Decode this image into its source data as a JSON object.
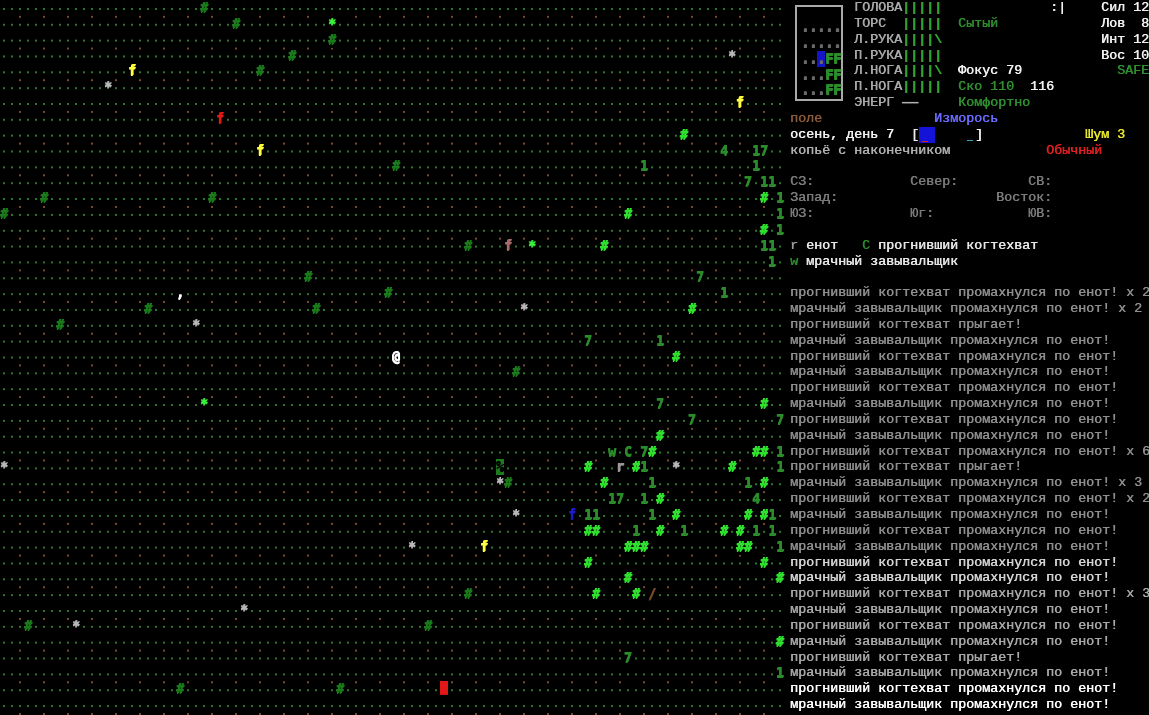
{
  "map": {
    "rows": [
      {
        "segments": [
          {
            "text": "                         #",
            "color": "#1b7a1b"
          }
        ]
      },
      {
        "segments": [
          {
            "text": "                             #",
            "color": "#1b7a1b"
          },
          {
            "text": "           *",
            "color": "#3af03a"
          }
        ]
      },
      {
        "segments": [
          {
            "text": "                                         #",
            "color": "#1b7a1b"
          }
        ]
      },
      {
        "segments": [
          {
            "text": "                                    #",
            "color": "#1b7a1b"
          },
          {
            "text": "                                                      *",
            "color": "#b8b8b8"
          }
        ]
      },
      {
        "segments": [
          {
            "text": "                f",
            "color": "#ffff40"
          },
          {
            "text": "               #",
            "color": "#1b7a1b"
          }
        ]
      },
      {
        "segments": [
          {
            "text": "             *",
            "color": "#b8b8b8"
          }
        ]
      },
      {
        "segments": [
          {
            "text": "                                                                                            f",
            "color": "#ffff40"
          }
        ]
      },
      {
        "segments": [
          {
            "text": "                           f",
            "color": "#e01818"
          }
        ]
      },
      {
        "segments": [
          {
            "text": "                                                                                     #",
            "color": "#30e030"
          }
        ]
      },
      {
        "segments": [
          {
            "text": "                                f",
            "color": "#ffff40"
          },
          {
            "text": "                                                         4",
            "color": "#2b8c2b"
          },
          {
            "text": "   17",
            "color": "#2b8c2b"
          }
        ]
      },
      {
        "segments": [
          {
            "text": "                                                 #",
            "color": "#1b7a1b"
          },
          {
            "text": "                              1",
            "color": "#2b8c2b"
          },
          {
            "text": "             1",
            "color": "#2b8c2b"
          }
        ]
      },
      {
        "segments": [
          {
            "text": "                                                                                             7",
            "color": "#2b8c2b"
          },
          {
            "text": " 11",
            "color": "#2b8c2b"
          }
        ]
      },
      {
        "segments": [
          {
            "text": "     #",
            "color": "#1b7a1b"
          },
          {
            "text": "                    #",
            "color": "#1b7a1b"
          },
          {
            "text": "                                                                    #",
            "color": "#30e030"
          },
          {
            "text": " 1",
            "color": "#2b8c2b"
          }
        ]
      },
      {
        "segments": [
          {
            "text": "#",
            "color": "#1b7a1b"
          },
          {
            "text": "                                                                             #",
            "color": "#30e030"
          },
          {
            "text": "                  1",
            "color": "#2b8c2b"
          }
        ]
      },
      {
        "segments": [
          {
            "text": "                                                                                               #",
            "color": "#30e030"
          },
          {
            "text": " 1",
            "color": "#2b8c2b"
          }
        ]
      },
      {
        "segments": [
          {
            "text": "                                                          #",
            "color": "#1b7a1b"
          },
          {
            "text": "    f",
            "color": "#a86a6a"
          },
          {
            "text": "  *",
            "color": "#3af03a"
          },
          {
            "text": "        #",
            "color": "#30e030"
          },
          {
            "text": "                   11",
            "color": "#2b8c2b"
          }
        ]
      },
      {
        "segments": [
          {
            "text": "                                                                                                1",
            "color": "#2b8c2b"
          }
        ]
      },
      {
        "segments": [
          {
            "text": "                                      #",
            "color": "#1b7a1b"
          },
          {
            "text": "                                                7",
            "color": "#2b8c2b"
          }
        ]
      },
      {
        "segments": [
          {
            "text": "                      ,",
            "color": "#ffffff"
          },
          {
            "text": "                         #",
            "color": "#1b7a1b"
          },
          {
            "text": "                                         1",
            "color": "#2b8c2b"
          }
        ]
      },
      {
        "segments": [
          {
            "text": "                  #",
            "color": "#1b7a1b"
          },
          {
            "text": "                    #",
            "color": "#1b7a1b"
          },
          {
            "text": "                         *",
            "color": "#b8b8b8"
          },
          {
            "text": "                    #",
            "color": "#30e030"
          }
        ]
      },
      {
        "segments": [
          {
            "text": "       #",
            "color": "#1b7a1b"
          },
          {
            "text": "                *",
            "color": "#b8b8b8"
          }
        ]
      },
      {
        "segments": [
          {
            "text": "                                                                         7",
            "color": "#2b8c2b"
          },
          {
            "text": "        1",
            "color": "#2b8c2b"
          }
        ]
      },
      {
        "segments": [
          {
            "text": "                                                 @",
            "color": "#ffffff"
          },
          {
            "text": "                                  #",
            "color": "#30e030"
          }
        ]
      },
      {
        "segments": [
          {
            "text": "                                                                #",
            "color": "#1b7a1b"
          }
        ]
      },
      {},
      {
        "segments": [
          {
            "text": "                         *",
            "color": "#3af03a"
          },
          {
            "text": "                                                        7",
            "color": "#2b8c2b"
          },
          {
            "text": "            #",
            "color": "#30e030"
          }
        ]
      },
      {
        "segments": [
          {
            "text": "                                                                                      7",
            "color": "#2b8c2b"
          },
          {
            "text": "          7",
            "color": "#2b8c2b"
          }
        ]
      },
      {
        "segments": [
          {
            "text": "                                                                                  #",
            "color": "#30e030"
          }
        ]
      },
      {
        "segments": [
          {
            "text": "                                                                            w",
            "color": "#2b8c2b"
          },
          {
            "text": " C",
            "color": "#2b8c2b"
          },
          {
            "text": " 7",
            "color": "#2b8c2b"
          },
          {
            "text": "#",
            "color": "#30e030"
          },
          {
            "text": "            ##",
            "color": "#30e030"
          },
          {
            "text": " 1",
            "color": "#2b8c2b"
          }
        ]
      },
      {
        "segments": [
          {
            "text": "*",
            "color": "#b8b8b8"
          },
          {
            "text": "                                                             %",
            "highlight": {
              "color": "#1d7a1d"
            }
          },
          {
            "text": "          #",
            "color": "#30e030"
          },
          {
            "text": "   r",
            "color": "#9a9a9a"
          },
          {
            "text": " #",
            "color": "#30e030"
          },
          {
            "text": "1",
            "color": "#2b8c2b"
          },
          {
            "text": "   *",
            "color": "#b8b8b8"
          },
          {
            "text": "      #",
            "color": "#30e030"
          },
          {
            "text": "     1",
            "color": "#2b8c2b"
          }
        ]
      },
      {
        "segments": [
          {
            "text": "                                                              *",
            "color": "#b8b8b8"
          },
          {
            "text": "#",
            "color": "#1b7a1b"
          },
          {
            "text": "           #",
            "color": "#30e030"
          },
          {
            "text": "     1",
            "color": "#2b8c2b"
          },
          {
            "text": "           1",
            "color": "#2b8c2b"
          },
          {
            "text": " #",
            "color": "#30e030"
          }
        ]
      },
      {
        "segments": [
          {
            "text": "                                                                            17",
            "color": "#2b8c2b"
          },
          {
            "text": "  1",
            "color": "#2b8c2b"
          },
          {
            "text": " #",
            "color": "#30e030"
          },
          {
            "text": "           4",
            "color": "#2b8c2b"
          }
        ]
      },
      {
        "segments": [
          {
            "text": "                                                                *",
            "color": "#b8b8b8"
          },
          {
            "text": "      f",
            "color": "#1c1cc8"
          },
          {
            "text": " 11",
            "color": "#2b8c2b"
          },
          {
            "text": "      1",
            "color": "#2b8c2b"
          },
          {
            "text": "  #",
            "color": "#30e030"
          },
          {
            "text": "        #",
            "color": "#30e030"
          },
          {
            "text": " #",
            "color": "#30e030"
          },
          {
            "text": "1",
            "color": "#2b8c2b"
          }
        ]
      },
      {
        "segments": [
          {
            "text": "                                                                         ##",
            "color": "#30e030"
          },
          {
            "text": "    1",
            "color": "#2b8c2b"
          },
          {
            "text": "  #",
            "color": "#30e030"
          },
          {
            "text": "  1",
            "color": "#2b8c2b"
          },
          {
            "text": "    #",
            "color": "#30e030"
          },
          {
            "text": " #",
            "color": "#30e030"
          },
          {
            "text": " 1",
            "color": "#2b8c2b"
          },
          {
            "text": " 1",
            "color": "#2b8c2b"
          }
        ]
      },
      {
        "segments": [
          {
            "text": "                                                   *",
            "color": "#b8b8b8"
          },
          {
            "text": "        f",
            "color": "#ffff40"
          },
          {
            "text": "                 ###",
            "color": "#30e030"
          },
          {
            "text": "           ##",
            "color": "#30e030"
          },
          {
            "text": "   1",
            "color": "#2b8c2b"
          }
        ]
      },
      {
        "segments": [
          {
            "text": "                                                                         #",
            "color": "#30e030"
          },
          {
            "text": "                     #",
            "color": "#30e030"
          }
        ]
      },
      {
        "segments": [
          {
            "text": "                                                                              #",
            "color": "#30e030"
          },
          {
            "text": "                  #",
            "color": "#30e030"
          }
        ]
      },
      {
        "segments": [
          {
            "text": "                                                          #",
            "color": "#1b7a1b"
          },
          {
            "text": "               #",
            "color": "#30e030"
          },
          {
            "text": "    #",
            "color": "#30e030"
          },
          {
            "text": " /",
            "color": "#7a4a2a"
          }
        ]
      },
      {
        "segments": [
          {
            "text": "                              *",
            "color": "#b8b8b8"
          }
        ]
      },
      {
        "segments": [
          {
            "text": "   #",
            "color": "#1b7a1b"
          },
          {
            "text": "     *",
            "color": "#b8b8b8"
          },
          {
            "text": "                                           #",
            "color": "#1b7a1b"
          }
        ]
      },
      {
        "segments": [
          {
            "text": "                                                                                                 #",
            "color": "#30e030"
          }
        ]
      },
      {
        "segments": [
          {
            "text": "                                                                              7",
            "color": "#2b8c2b"
          }
        ]
      },
      {
        "segments": [
          {
            "text": "                                                                                                 1",
            "color": "#2b8c2b"
          }
        ]
      },
      {
        "segments": [
          {
            "text": "                      #",
            "color": "#1b7a1b"
          },
          {
            "text": "                   #",
            "color": "#1b7a1b"
          },
          {
            "text": "            _",
            "highlight": {
              "color": "#e01818"
            }
          }
        ]
      }
    ]
  },
  "minimap": {
    "rows": [
      {
        "segments": [
          {
            "text": ".....",
            "color": "#6a6a6a",
            "highlighted": false
          }
        ]
      },
      {
        "segments": [
          {
            "text": ".....",
            "color": "#6a6a6a",
            "highlighted": false
          }
        ]
      },
      {
        "segments": [
          {
            "text": "..",
            "color": "#6a6a6a",
            "highlighted": false
          },
          {
            "text": ".",
            "highlighted": true
          },
          {
            "text": "FF",
            "color": "#2b8c2b",
            "highlighted": false
          }
        ]
      },
      {
        "segments": [
          {
            "text": "...",
            "color": "#6a6a6a",
            "highlighted": false
          },
          {
            "text": "FF",
            "color": "#2b8c2b",
            "highlighted": false
          }
        ]
      },
      {
        "segments": [
          {
            "text": "...",
            "color": "#6a6a6a",
            "highlighted": false
          },
          {
            "text": "FF",
            "color": "#2b8c2b",
            "highlighted": false
          }
        ]
      }
    ]
  },
  "body_parts": [
    {
      "label": "ГОЛОВА",
      "bar": "|||||",
      "color": "#2fa02f"
    },
    {
      "label": "ТОРС",
      "bar": "|||||",
      "color": "#2fa02f"
    },
    {
      "label": "Л.РУКА",
      "bar": "||||\\",
      "color": "#2fa02f"
    },
    {
      "label": "П.РУКА",
      "bar": "|||||",
      "color": "#2fa02f"
    },
    {
      "label": "Л.НОГА",
      "bar": "||||\\",
      "color": "#2fa02f"
    },
    {
      "label": "П.НОГА",
      "bar": "|||||",
      "color": "#2fa02f"
    },
    {
      "label": "ЭНЕРГ",
      "bar": "——",
      "color": "#b0b0b0"
    }
  ],
  "status": {
    "mood": ":|",
    "hunger": "Сытый",
    "focus": "Фокус 79",
    "speed": "Ско 110",
    "move_cost": "116",
    "comfort": "Комфортно",
    "safe_mode": "SAFE"
  },
  "stats": [
    {
      "label": "Сил",
      "value": "12"
    },
    {
      "label": "Лов",
      "value": "8"
    },
    {
      "label": "Инт",
      "value": "12"
    },
    {
      "label": "Вос",
      "value": "10"
    }
  ],
  "location": "поле",
  "weather": "Изморось",
  "date": "осень, день 7",
  "light_meter": {
    "left": "[",
    "right": "]",
    "level": 0.29
  },
  "noise": "Шум 3",
  "weapon": "копьё с наконечником",
  "combat_style": "Обычный",
  "compass": [
    {
      "west": "СЗ:",
      "center": "Север:",
      "east": "СВ:"
    },
    {
      "west": "Запад:",
      "east": "Восток:"
    },
    {
      "west": "ЮЗ:",
      "center": "Юг:",
      "east": "ЮВ:"
    }
  ],
  "monsters": [
    [
      {
        "glyph": "r",
        "color": "#9a9a9a",
        "name": "енот"
      },
      {
        "glyph": "C",
        "color": "#2b8c2b",
        "name": "прогнивший когтехват"
      }
    ],
    [
      {
        "glyph": "w",
        "color": "#2b8c2b",
        "name": "мрачный завывальщик"
      }
    ]
  ],
  "log": [
    {
      "text": "прогнивший когтехват промахнулся по енот! x 2",
      "color": "#8e8e8e"
    },
    {
      "text": "мрачный завывальщик промахнулся по енот! x 2",
      "color": "#8e8e8e"
    },
    {
      "text": "прогнивший когтехват прыгает!",
      "color": "#8e8e8e"
    },
    {
      "text": "мрачный завывальщик промахнулся по енот!",
      "color": "#8e8e8e"
    },
    {
      "text": "прогнивший когтехват промахнулся по енот!",
      "color": "#8e8e8e"
    },
    {
      "text": "мрачный завывальщик промахнулся по енот!",
      "color": "#8e8e8e"
    },
    {
      "text": "прогнивший когтехват промахнулся по енот!",
      "color": "#8e8e8e"
    },
    {
      "text": "мрачный завывальщик промахнулся по енот!",
      "color": "#8e8e8e"
    },
    {
      "text": "прогнивший когтехват промахнулся по енот!",
      "color": "#8e8e8e"
    },
    {
      "text": "мрачный завывальщик промахнулся по енот!",
      "color": "#8e8e8e"
    },
    {
      "text": "прогнивший когтехват промахнулся по енот! x 6",
      "color": "#8e8e8e"
    },
    {
      "text": "прогнивший когтехват прыгает!",
      "color": "#8e8e8e"
    },
    {
      "text": "мрачный завывальщик промахнулся по енот! x 3",
      "color": "#8e8e8e"
    },
    {
      "text": "прогнивший когтехват промахнулся по енот! x 2",
      "color": "#8e8e8e"
    },
    {
      "text": "мрачный завывальщик промахнулся по енот!",
      "color": "#8e8e8e"
    },
    {
      "text": "прогнивший когтехват промахнулся по енот!",
      "color": "#8e8e8e"
    },
    {
      "text": "мрачный завывальщик промахнулся по енот!",
      "color": "#8e8e8e"
    },
    {
      "text": "прогнивший когтехват промахнулся по енот!",
      "color": "#d4d4d4"
    },
    {
      "text": "мрачный завывальщик промахнулся по енот!",
      "color": "#d4d4d4"
    },
    {
      "text": "прогнивший когтехват промахнулся по енот! x 3",
      "color": "#a8a8a8"
    },
    {
      "text": "мрачный завывальщик промахнулся по енот!",
      "color": "#a8a8a8"
    },
    {
      "text": "прогнивший когтехват промахнулся по енот!",
      "color": "#a8a8a8"
    },
    {
      "text": "мрачный завывальщик промахнулся по енот!",
      "color": "#a8a8a8"
    },
    {
      "text": "прогнивший когтехват прыгает!",
      "color": "#a8a8a8"
    },
    {
      "text": "мрачный завывальщик промахнулся по енот!",
      "color": "#a8a8a8"
    },
    {
      "text": "прогнивший когтехват промахнулся по енот!",
      "color": "#ffffff"
    },
    {
      "text": "мрачный завывальщик промахнулся по енот!",
      "color": "#ffffff"
    }
  ]
}
